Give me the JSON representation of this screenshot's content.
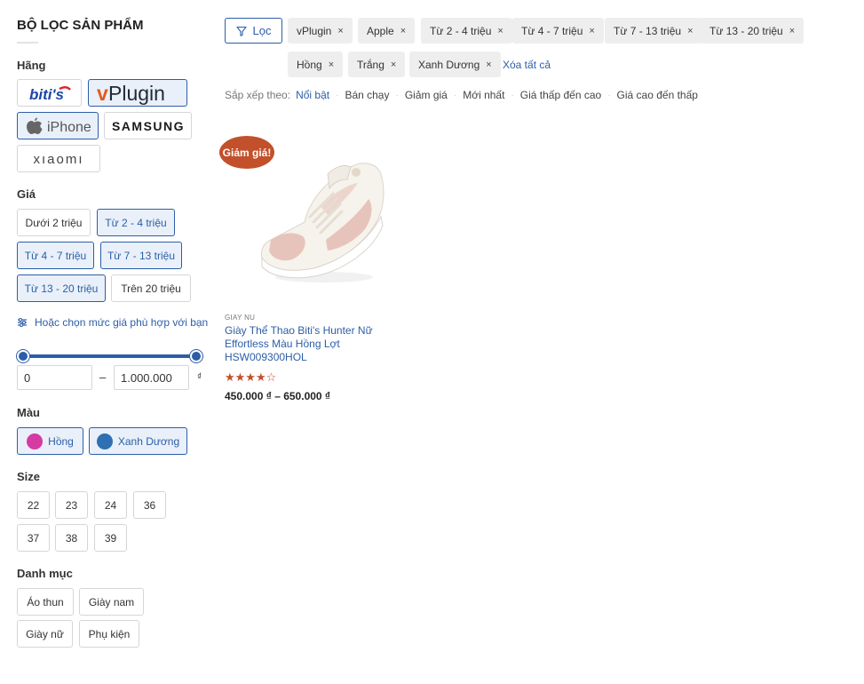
{
  "sidebar": {
    "title": "BỘ LỌC SẢN PHẨM",
    "brand_label": "Hãng",
    "brands": [
      {
        "name": "biti's",
        "icon": "bitis-logo",
        "active": false
      },
      {
        "name": "vPlugin",
        "icon": "vplugin-logo",
        "active": true
      },
      {
        "name": "iPhone",
        "icon": "apple-logo",
        "active": true
      },
      {
        "name": "SAMSUNG",
        "icon": "samsung-logo",
        "active": false
      },
      {
        "name": "xiaomi",
        "icon": "xiaomi-logo",
        "active": false
      }
    ],
    "price_label": "Giá",
    "prices": [
      {
        "label": "Dưới 2 triệu",
        "active": false
      },
      {
        "label": "Từ 2 - 4 triệu",
        "active": true
      },
      {
        "label": "Từ 4 - 7 triệu",
        "active": true
      },
      {
        "label": "Từ 7 - 13 triệu",
        "active": true
      },
      {
        "label": "Từ 13 - 20 triệu",
        "active": true
      },
      {
        "label": "Trên 20 triệu",
        "active": false
      }
    ],
    "price_range_link": "Hoặc chọn mức giá phù hợp với bạn",
    "price_min": "0",
    "price_max": "1.000.000",
    "price_dash": "–",
    "currency": "₫",
    "color_label": "Màu",
    "colors": [
      {
        "label": "Hồng",
        "hex": "#d63aa3",
        "active": true
      },
      {
        "label": "Xanh Dương",
        "hex": "#2f6fb3",
        "active": true
      }
    ],
    "size_label": "Size",
    "sizes": [
      "22",
      "23",
      "24",
      "36",
      "37",
      "38",
      "39"
    ],
    "category_label": "Danh mục",
    "categories": [
      "Áo thun",
      "Giày nam",
      "Giày nữ",
      "Phụ kiện"
    ]
  },
  "filters": {
    "button_label": "Lọc",
    "tags": [
      "vPlugin",
      "Apple",
      "Từ 2 - 4 triệu",
      "Từ 4 - 7 triệu",
      "Từ 7 - 13 triệu",
      "Từ 13 - 20 triệu",
      "Hồng",
      "Trắng",
      "Xanh Dương"
    ],
    "remove_symbol": "×",
    "clear_all": "Xóa tất cả"
  },
  "sort": {
    "label": "Sắp xếp theo:",
    "options": [
      "Nổi bật",
      "Bán chạy",
      "Giảm giá",
      "Mới nhất",
      "Giá thấp đến cao",
      "Giá cao đến thấp"
    ],
    "active_index": 0
  },
  "products": [
    {
      "badge": "Giảm giá!",
      "category": "GIAY NU",
      "name": "Giày Thể Thao Biti's Hunter Nữ Effortless Màu Hồng Lợt HSW009300HOL",
      "rating": 4,
      "rating_max": 5,
      "stars_text": "★★★★☆",
      "price": "450.000 ₫ – 650.000 ₫",
      "accent": "#c2502b"
    }
  ],
  "theme": {
    "primary": "#2c5ea8",
    "sale": "#c2502b"
  }
}
